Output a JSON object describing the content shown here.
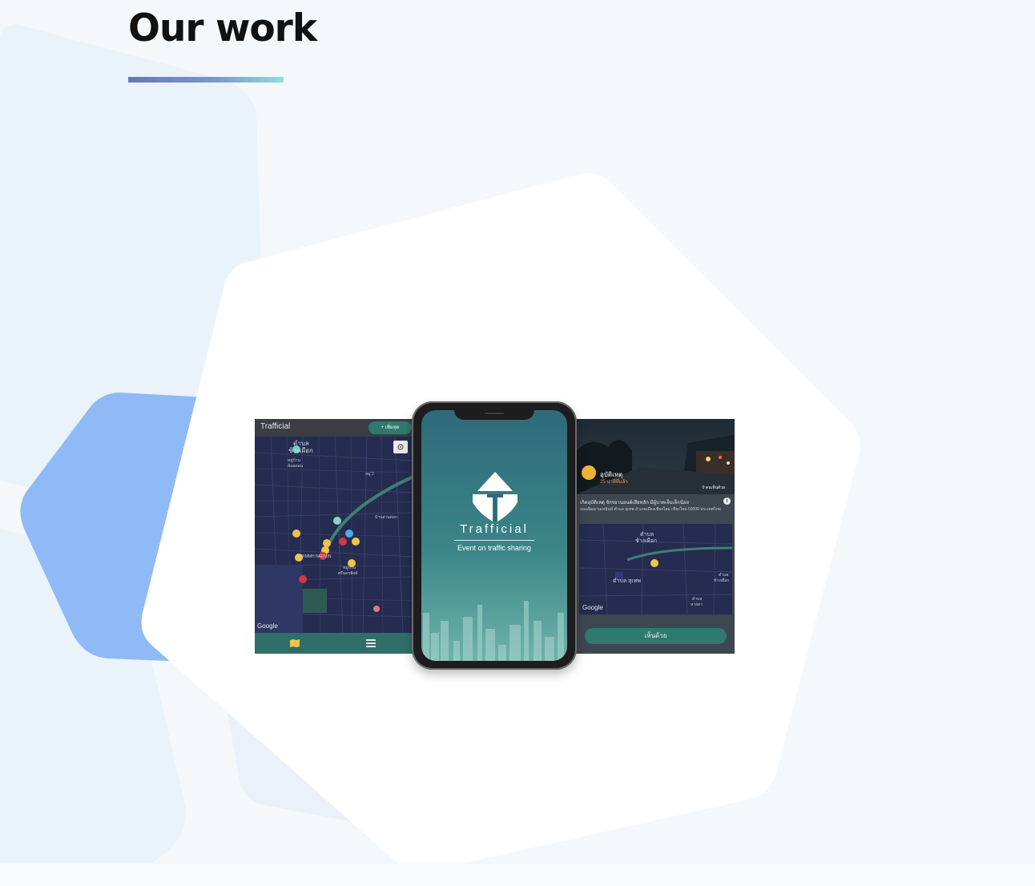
{
  "page": {
    "heading": "Our work"
  },
  "left_screen": {
    "app_title": "Trafficial",
    "add_button": "+ เพิ่มจุด",
    "map_labels": [
      "ตำบล",
      "ช้างเผือก",
      "หมู่บ้าน",
      "ล้อมดอน",
      "หมู่ 2",
      "บ้านสวนดอก",
      "หมู่บ้าน",
      "ศรีนครพิงค์",
      "BIMMH NAEMIN"
    ],
    "map_attribution": "Google"
  },
  "phone": {
    "app_name": "Trafficial",
    "tagline": "Event on traffic sharing"
  },
  "right_screen": {
    "event_type": "อุบัติเหตุ",
    "event_time": "25 นาทีที่แล้ว",
    "agree_count": "0 คนเห็นด้วย",
    "event_title": "เกิดอุบัติเหตุ จักรยานยนต์เสียหลัก มีผู้บาดเจ็บเล็กน้อย",
    "event_address": "ถนนนิมมานเหมินท์ ตำบล สุเทพ อำเภอเมืองเชียงใหม่ เชียงใหม่ 50000 ประเทศไทย",
    "map_labels": [
      "ตำบล",
      "ช้างเผือก",
      "ตำบล สุเทพ",
      "ตำบล",
      "ช้างเผือก",
      "ตำบล",
      "หายยา"
    ],
    "map_attribution": "Google",
    "agree_button": "เห็นด้วย"
  },
  "colors": {
    "accent_teal": "#2f7a6e",
    "map_navy": "#252c4f",
    "heading_underline": "#6a78ad"
  }
}
